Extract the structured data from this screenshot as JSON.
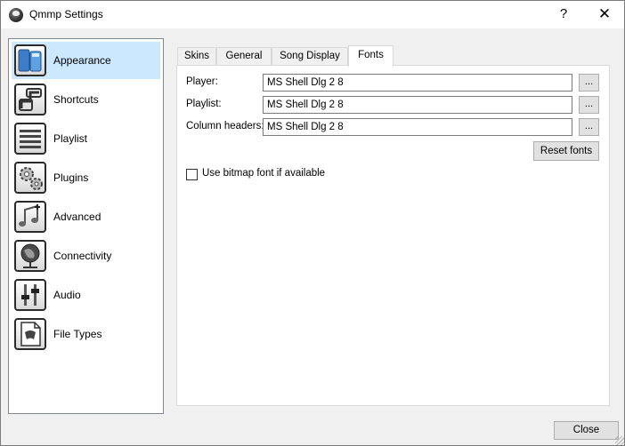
{
  "window": {
    "title": "Qmmp Settings",
    "help_glyph": "?",
    "close_glyph": "✕"
  },
  "sidebar": {
    "selected": "Appearance",
    "items": [
      {
        "label": "Appearance",
        "icon": "appearance-icon"
      },
      {
        "label": "Shortcuts",
        "icon": "shortcuts-icon"
      },
      {
        "label": "Playlist",
        "icon": "playlist-icon"
      },
      {
        "label": "Plugins",
        "icon": "plugins-icon"
      },
      {
        "label": "Advanced",
        "icon": "advanced-icon"
      },
      {
        "label": "Connectivity",
        "icon": "connectivity-icon"
      },
      {
        "label": "Audio",
        "icon": "audio-icon"
      },
      {
        "label": "File Types",
        "icon": "file-types-icon"
      }
    ]
  },
  "tabs": {
    "active": "Fonts",
    "items": [
      "Skins",
      "General",
      "Song Display",
      "Fonts"
    ]
  },
  "fonts": {
    "player_label": "Player:",
    "player_value": "MS Shell Dlg 2 8",
    "playlist_label": "Playlist:",
    "playlist_value": "MS Shell Dlg 2 8",
    "column_headers_label": "Column headers:",
    "column_headers_value": "MS Shell Dlg 2 8",
    "browse_label": "...",
    "reset_label": "Reset fonts",
    "bitmap_checkbox_label": "Use bitmap font if available",
    "bitmap_checked": false
  },
  "footer": {
    "close_label": "Close"
  }
}
